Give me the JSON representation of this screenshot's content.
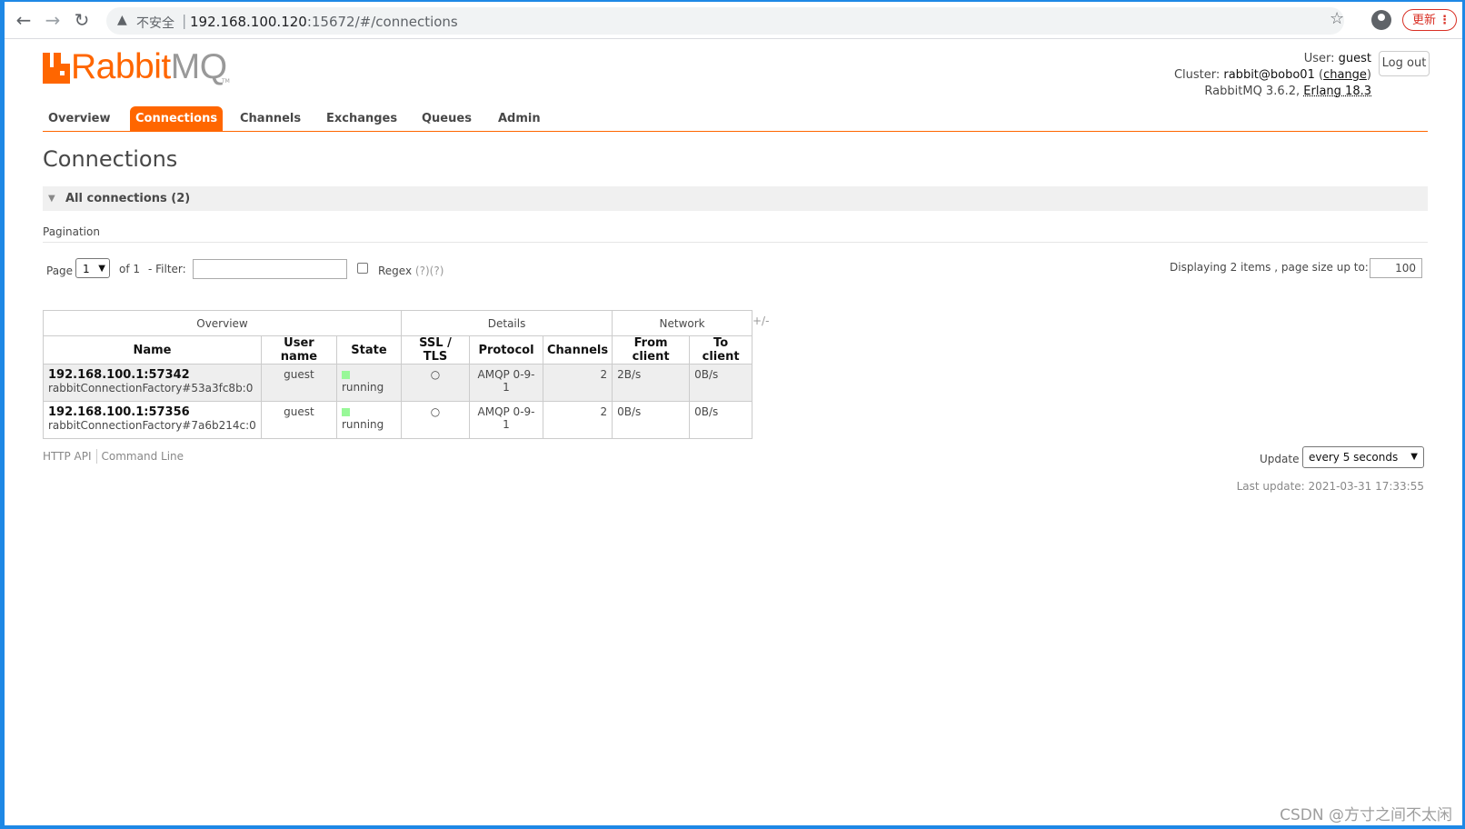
{
  "browser": {
    "security_label": "不安全",
    "url_host": "192.168.100.120",
    "url_rest": ":15672/#/connections",
    "update_button": "更新",
    "menu_glyph": "⋮"
  },
  "header": {
    "logo_rabbit": "Rabbit",
    "logo_mq": "MQ",
    "logo_tm": "TM",
    "user_label": "User:",
    "user_value": "guest",
    "cluster_label": "Cluster:",
    "cluster_value": "rabbit@bobo01",
    "change_label": "change",
    "version_text": "RabbitMQ 3.6.2,",
    "erlang_text": "Erlang 18.3",
    "logout_label": "Log out"
  },
  "tabs": [
    {
      "label": "Overview"
    },
    {
      "label": "Connections"
    },
    {
      "label": "Channels"
    },
    {
      "label": "Exchanges"
    },
    {
      "label": "Queues"
    },
    {
      "label": "Admin"
    }
  ],
  "page_title": "Connections",
  "section": {
    "label": "All connections (2)"
  },
  "pagination": {
    "heading": "Pagination",
    "page_label": "Page",
    "page_value": "1",
    "of_label": "of 1",
    "filter_label": "- Filter:",
    "regex_label": "Regex",
    "regex_help": "(?)(?)",
    "display_text": "Displaying 2 items , page size up to:",
    "page_size": "100"
  },
  "table": {
    "groups": [
      "Overview",
      "Details",
      "Network"
    ],
    "columns": [
      "Name",
      "User name",
      "State",
      "SSL / TLS",
      "Protocol",
      "Channels",
      "From client",
      "To client"
    ],
    "plus_minus": "+/-",
    "rows": [
      {
        "name": "192.168.100.1:57342",
        "sub": "rabbitConnectionFactory#53a3fc8b:0",
        "user": "guest",
        "state": "running",
        "ssl": "○",
        "protocol": "AMQP 0-9-1",
        "channels": "2",
        "from_client": "2B/s",
        "to_client": "0B/s"
      },
      {
        "name": "192.168.100.1:57356",
        "sub": "rabbitConnectionFactory#7a6b214c:0",
        "user": "guest",
        "state": "running",
        "ssl": "○",
        "protocol": "AMQP 0-9-1",
        "channels": "2",
        "from_client": "0B/s",
        "to_client": "0B/s"
      }
    ]
  },
  "footer": {
    "http_api": "HTTP API",
    "command_line": "Command Line",
    "update_label": "Update",
    "update_value": "every 5 seconds",
    "last_update": "Last update: 2021-03-31 17:33:55"
  },
  "watermark": "CSDN @方寸之间不太闲",
  "colors": {
    "accent": "#ff6600",
    "running": "#98f898",
    "frame": "#1e88e5"
  }
}
